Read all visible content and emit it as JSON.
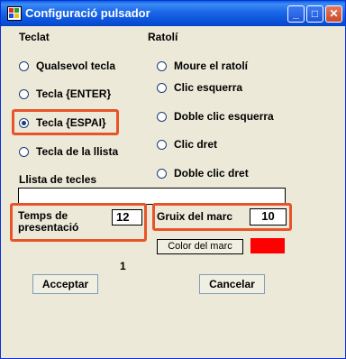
{
  "window": {
    "title": "Configuració pulsador",
    "minimize_glyph": "_",
    "maximize_glyph": "□",
    "close_glyph": "✕"
  },
  "teclat": {
    "heading": "Teclat",
    "options": [
      {
        "label": "Qualsevol tecla",
        "selected": false
      },
      {
        "label": "Tecla {ENTER}",
        "selected": false
      },
      {
        "label": "Tecla {ESPAI}",
        "selected": true
      },
      {
        "label": "Tecla de la llista",
        "selected": false
      }
    ]
  },
  "ratoli": {
    "heading": "Ratolí",
    "options": [
      {
        "label": "Moure el ratolí",
        "selected": false
      },
      {
        "label": "Clic esquerra",
        "selected": false
      },
      {
        "label": "Doble clic esquerra",
        "selected": false
      },
      {
        "label": "Clic dret",
        "selected": false
      },
      {
        "label": "Doble clic dret",
        "selected": false
      }
    ]
  },
  "llista": {
    "label": "Llista de tecles",
    "value": ""
  },
  "temps": {
    "label_line1": "Temps de",
    "label_line2": "presentació",
    "value": "12"
  },
  "gruix": {
    "label": "Gruix del marc",
    "value": "10"
  },
  "color_button": {
    "label": "Color del marc",
    "swatch_color": "#FF0000"
  },
  "counter": "1",
  "buttons": {
    "accept": "Acceptar",
    "cancel": "Cancelar"
  },
  "colors": {
    "highlight": "#E8542A",
    "titlebar": "#0A52DA"
  }
}
